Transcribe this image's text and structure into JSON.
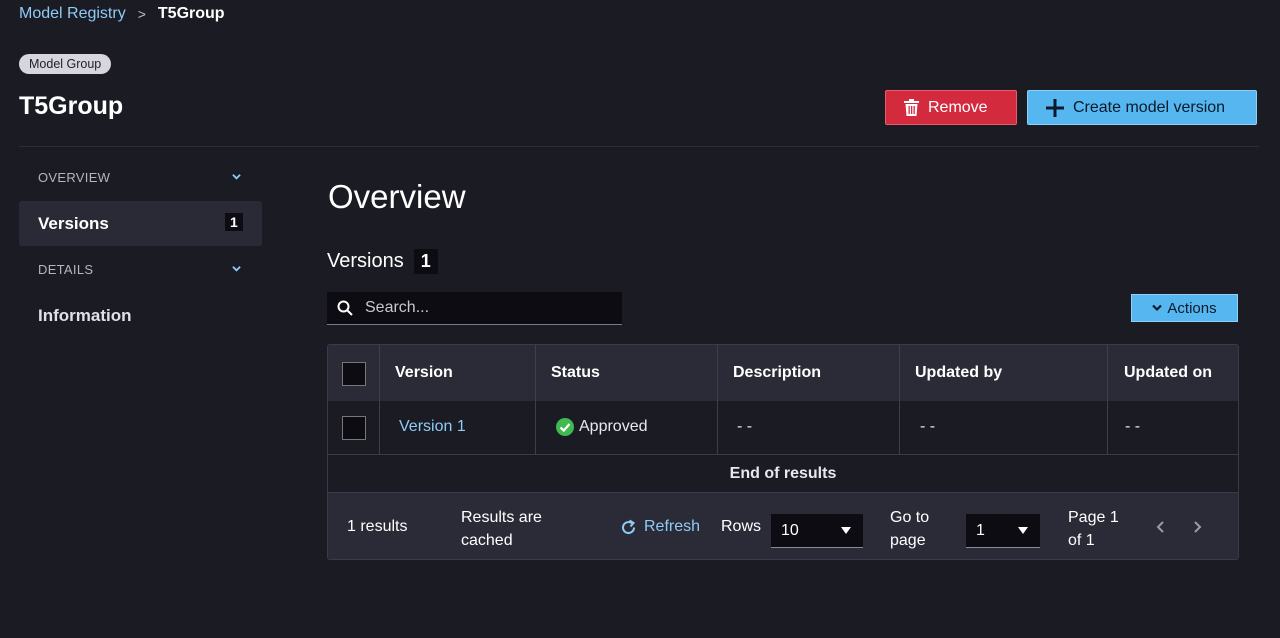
{
  "breadcrumb": {
    "root": "Model Registry",
    "separator": ">",
    "current": "T5Group"
  },
  "header": {
    "type_badge": "Model Group",
    "title": "T5Group",
    "remove_label": "Remove",
    "create_label": "Create model version"
  },
  "sidebar": {
    "overview_section": "OVERVIEW",
    "versions_label": "Versions",
    "versions_count": "1",
    "details_section": "DETAILS",
    "information_label": "Information"
  },
  "main": {
    "title": "Overview",
    "versions_heading": "Versions",
    "versions_count": "1",
    "search_placeholder": "Search...",
    "actions_label": "Actions",
    "columns": [
      "Version",
      "Status",
      "Description",
      "Updated by",
      "Updated on"
    ],
    "rows": [
      {
        "version": "Version 1",
        "status": "Approved",
        "description": "- -",
        "updated_by": "- -",
        "updated_on": "- -"
      }
    ],
    "end_label": "End of results",
    "footer": {
      "results": "1 results",
      "cached_line1": "Results are",
      "cached_line2": "cached",
      "refresh": "Refresh",
      "rows_label": "Rows",
      "rows_value": "10",
      "goto_line1": "Go to",
      "goto_line2": "page",
      "goto_value": "1",
      "page_line1": "Page 1",
      "page_line2": "of 1"
    }
  },
  "colors": {
    "accent": "#55b6f0",
    "danger": "#d32a3e",
    "link": "#8ecbf5",
    "success": "#3fb950",
    "background": "#1b1b24"
  }
}
